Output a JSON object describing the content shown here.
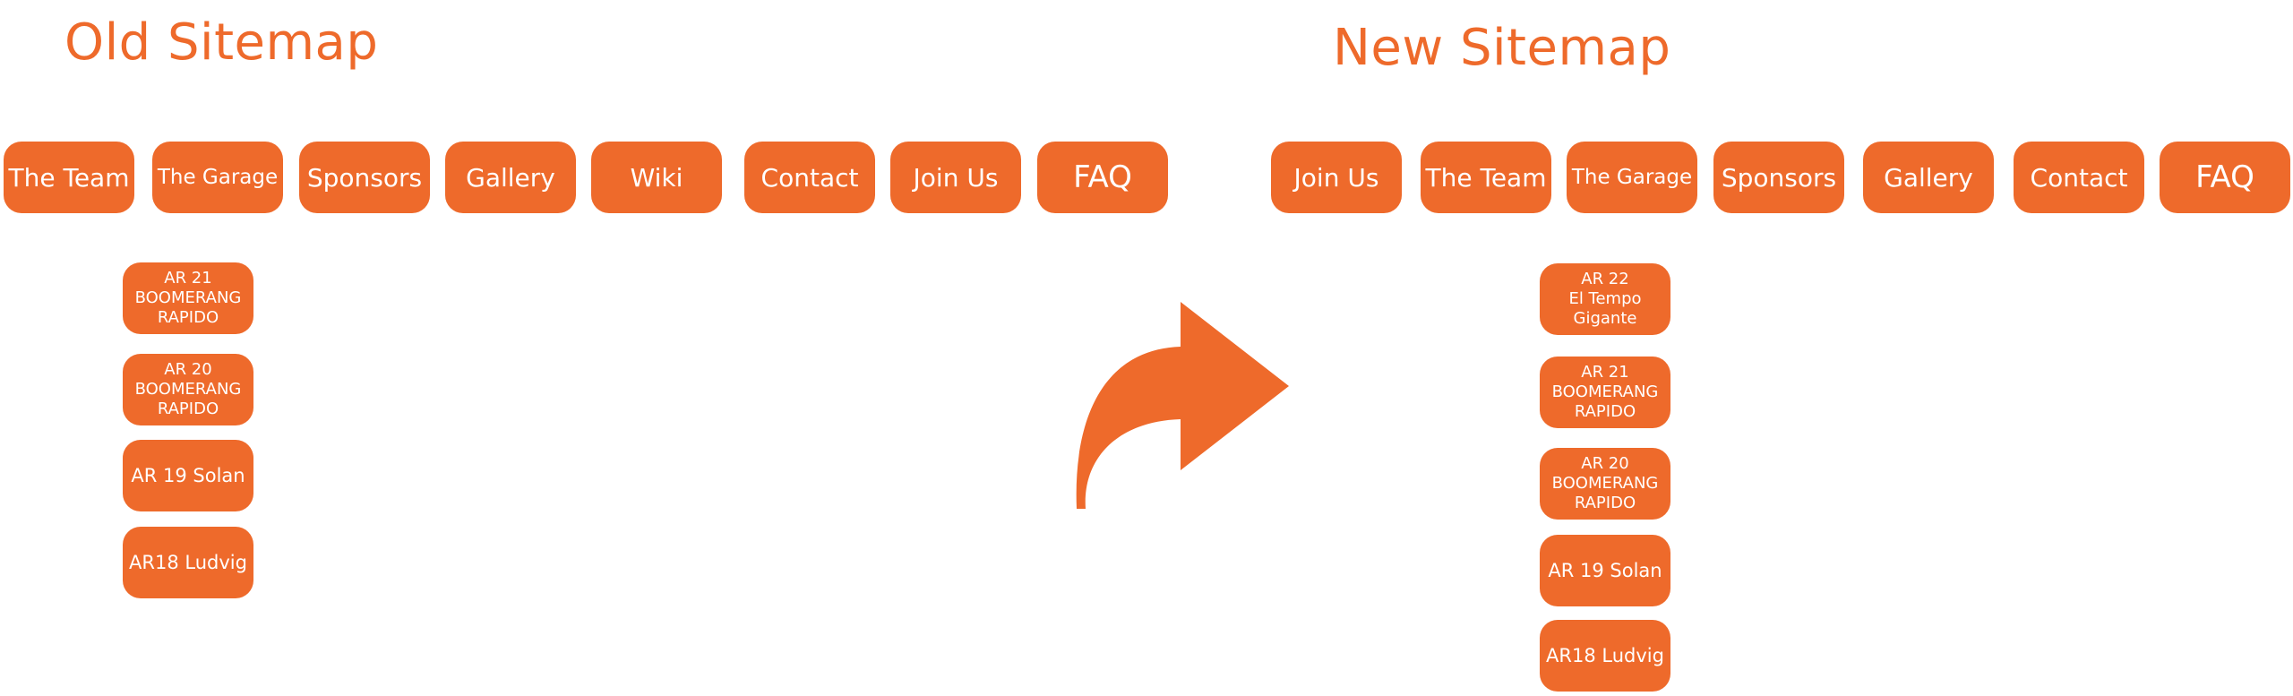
{
  "colors": {
    "accent": "#EE6A2B",
    "background": "#FFFFFF",
    "label": "#FFFFFF"
  },
  "old_sitemap": {
    "title": "Old Sitemap",
    "nav": [
      {
        "label": "The Team"
      },
      {
        "label": "The Garage"
      },
      {
        "label": "Sponsors"
      },
      {
        "label": "Gallery"
      },
      {
        "label": "Wiki"
      },
      {
        "label": "Contact"
      },
      {
        "label": "Join Us"
      },
      {
        "label": "FAQ"
      }
    ],
    "garage_children": [
      {
        "label": "AR 21\nBOOMERANG\nRAPIDO"
      },
      {
        "label": "AR 20\nBOOMERANG\nRAPIDO"
      },
      {
        "label": "AR 19 Solan"
      },
      {
        "label": "AR18 Ludvig"
      }
    ]
  },
  "transition_arrow": {
    "icon": "curved-arrow-right-icon"
  },
  "new_sitemap": {
    "title": "New Sitemap",
    "nav": [
      {
        "label": "Join Us"
      },
      {
        "label": "The Team"
      },
      {
        "label": "The Garage"
      },
      {
        "label": "Sponsors"
      },
      {
        "label": "Gallery"
      },
      {
        "label": "Contact"
      },
      {
        "label": "FAQ"
      }
    ],
    "garage_children": [
      {
        "label": "AR 22\nEl Tempo\nGigante"
      },
      {
        "label": "AR 21\nBOOMERANG\nRAPIDO"
      },
      {
        "label": "AR 20\nBOOMERANG\nRAPIDO"
      },
      {
        "label": "AR 19 Solan"
      },
      {
        "label": "AR18 Ludvig"
      }
    ]
  }
}
